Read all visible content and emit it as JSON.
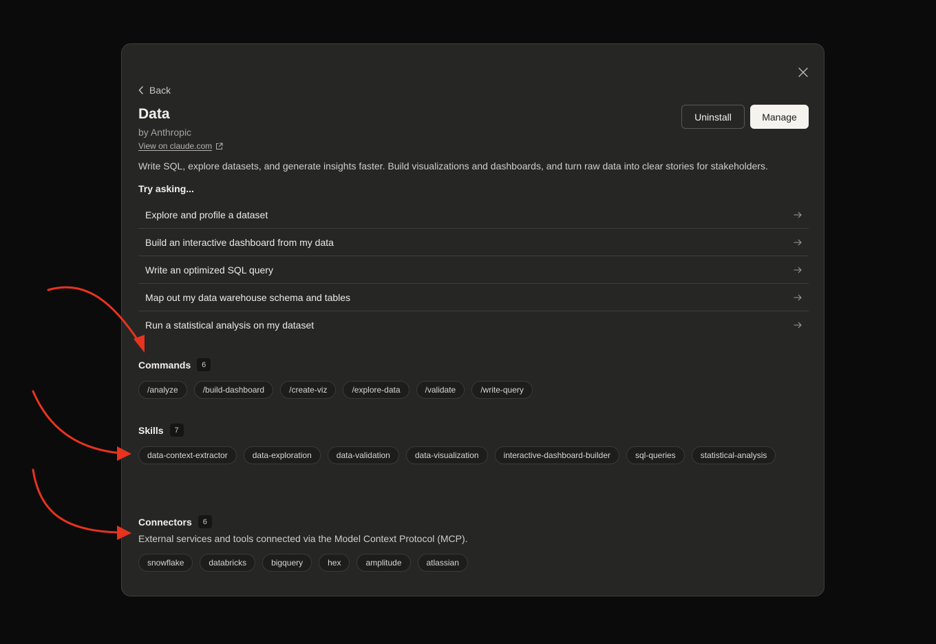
{
  "back_label": "Back",
  "title": "Data",
  "byline": "by Anthropic",
  "view_link": "View on claude.com",
  "buttons": {
    "uninstall": "Uninstall",
    "manage": "Manage"
  },
  "description": "Write SQL, explore datasets, and generate insights faster. Build visualizations and dashboards, and turn raw data into clear stories for stakeholders.",
  "try_asking": {
    "heading": "Try asking...",
    "prompts": [
      "Explore and profile a dataset",
      "Build an interactive dashboard from my data",
      "Write an optimized SQL query",
      "Map out my data warehouse schema and tables",
      "Run a statistical analysis on my dataset"
    ]
  },
  "commands": {
    "title": "Commands",
    "count": "6",
    "items": [
      "/analyze",
      "/build-dashboard",
      "/create-viz",
      "/explore-data",
      "/validate",
      "/write-query"
    ]
  },
  "skills": {
    "title": "Skills",
    "count": "7",
    "items": [
      "data-context-extractor",
      "data-exploration",
      "data-validation",
      "data-visualization",
      "interactive-dashboard-builder",
      "sql-queries",
      "statistical-analysis"
    ]
  },
  "connectors": {
    "title": "Connectors",
    "count": "6",
    "description": "External services and tools connected via the Model Context Protocol (MCP).",
    "items": [
      "snowflake",
      "databricks",
      "bigquery",
      "hex",
      "amplitude",
      "atlassian"
    ]
  },
  "colors": {
    "page_background": "#0b0b0b",
    "modal_background": "#262625",
    "annotation_arrow": "#e8331e"
  }
}
